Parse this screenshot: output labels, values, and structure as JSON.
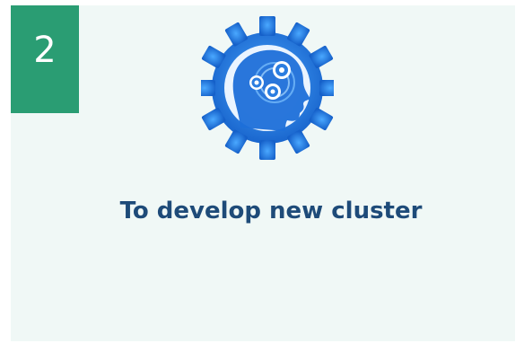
{
  "badge": {
    "number": "2",
    "color": "#2a9d73"
  },
  "illustration": {
    "icon": "gear-head-icon",
    "primary_color": "#1e6fd9"
  },
  "title": {
    "text": "To develop new cluster",
    "color": "#1e4b79"
  },
  "card": {
    "background": "#f0f8f6"
  }
}
